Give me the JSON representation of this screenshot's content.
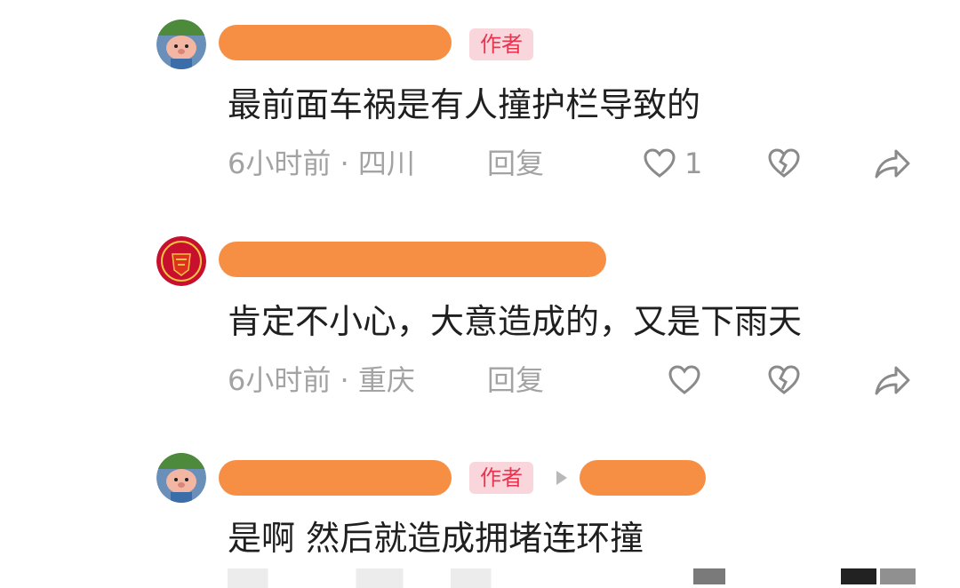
{
  "comments": [
    {
      "badge": "作者",
      "text": "最前面车祸是有人撞护栏导致的",
      "meta": "6小时前 · 四川",
      "reply_label": "回复",
      "like_count": "1"
    },
    {
      "badge": "",
      "text": "肯定不小心，大意造成的，又是下雨天",
      "meta": "6小时前 · 重庆",
      "reply_label": "回复",
      "like_count": ""
    },
    {
      "badge": "作者",
      "text": "是啊 然后就造成拥堵连环撞",
      "meta": "",
      "reply_label": "",
      "like_count": ""
    }
  ],
  "colors": {
    "redaction": "#f5883a",
    "badge_bg": "#f9d6dc",
    "badge_text": "#e8344f",
    "meta_text": "#a3a3a3"
  },
  "icons": {
    "like": "heart-outline-icon",
    "dislike": "broken-heart-icon",
    "share": "share-arrow-icon"
  }
}
